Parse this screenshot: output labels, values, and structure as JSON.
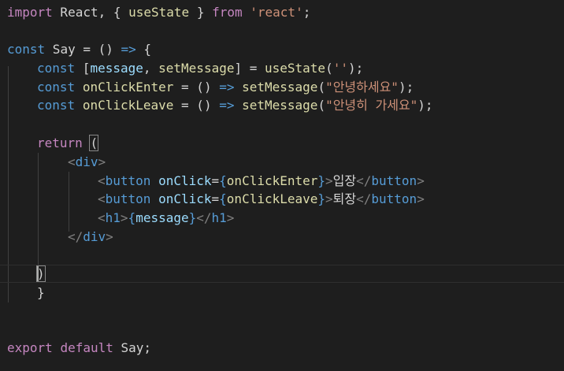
{
  "colors": {
    "keyword_purple": "#c586c0",
    "keyword_blue": "#569cd6",
    "identifier": "#9cdcfe",
    "function": "#dcdcaa",
    "string": "#ce9178",
    "text": "#d4d4d4",
    "tag": "#569cd6",
    "tag_bracket": "#808080",
    "background": "#1e1e1e"
  },
  "code": {
    "line1": {
      "k_import": "import",
      "t_react": " React, { ",
      "f_usestate": "useState",
      "t_close": " } ",
      "k_from": "from",
      "t_sp": " ",
      "s_react": "'react'",
      "t_semi": ";"
    },
    "line3": {
      "k_const": "const",
      "t_say": " Say = () ",
      "k_arrow": "=>",
      "t_brace": " {"
    },
    "line4": {
      "k_const": "const",
      "t_open": " [",
      "v_message": "message",
      "t_comma": ", ",
      "v_setmessage": "setMessage",
      "t_eq": "] = ",
      "f_usestate": "useState",
      "t_paren": "(",
      "s_empty": "''",
      "t_end": ");"
    },
    "line5": {
      "k_const": "const",
      "t_sp": " ",
      "v_name": "onClickEnter",
      "t_eq": " = () ",
      "k_arrow": "=>",
      "t_sp2": " ",
      "f_set": "setMessage",
      "t_paren": "(",
      "s_msg": "\"안녕하세요\"",
      "t_end": ");"
    },
    "line6": {
      "k_const": "const",
      "t_sp": " ",
      "v_name": "onClickLeave",
      "t_eq": " = () ",
      "k_arrow": "=>",
      "t_sp2": " ",
      "f_set": "setMessage",
      "t_paren": "(",
      "s_msg": "\"안녕히 가세요\"",
      "t_end": ");"
    },
    "line8": {
      "k_return": "return",
      "t_sp": " ",
      "t_paren": "("
    },
    "line9": {
      "tb_open": "<",
      "tag_div": "div",
      "tb_close": ">"
    },
    "line10": {
      "tb_open": "<",
      "tag_button": "button",
      "t_sp": " ",
      "a_onclick": "onClick",
      "t_eq": "=",
      "t_lb": "{",
      "v_handler": "onClickEnter",
      "t_rb": "}",
      "tb_close": ">",
      "t_label": "입장",
      "tb_end_open": "</",
      "tag_button_end": "button",
      "tb_end_close": ">"
    },
    "line11": {
      "tb_open": "<",
      "tag_button": "button",
      "t_sp": " ",
      "a_onclick": "onClick",
      "t_eq": "=",
      "t_lb": "{",
      "v_handler": "onClickLeave",
      "t_rb": "}",
      "tb_close": ">",
      "t_label": "퇴장",
      "tb_end_open": "</",
      "tag_button_end": "button",
      "tb_end_close": ">"
    },
    "line12": {
      "tb_open": "<",
      "tag_h1": "h1",
      "tb_close": ">",
      "t_lb": "{",
      "v_message": "message",
      "t_rb": "}",
      "tb_end_open": "</",
      "tag_h1_end": "h1",
      "tb_end_close": ">"
    },
    "line13": {
      "tb_end_open": "</",
      "tag_div_end": "div",
      "tb_end_close": ">"
    },
    "line15": {
      "t_paren": ")"
    },
    "line16": {
      "t_brace": "}"
    },
    "line19": {
      "k_export": "export",
      "t_sp": " ",
      "k_default": "default",
      "t_say": " Say;"
    }
  }
}
